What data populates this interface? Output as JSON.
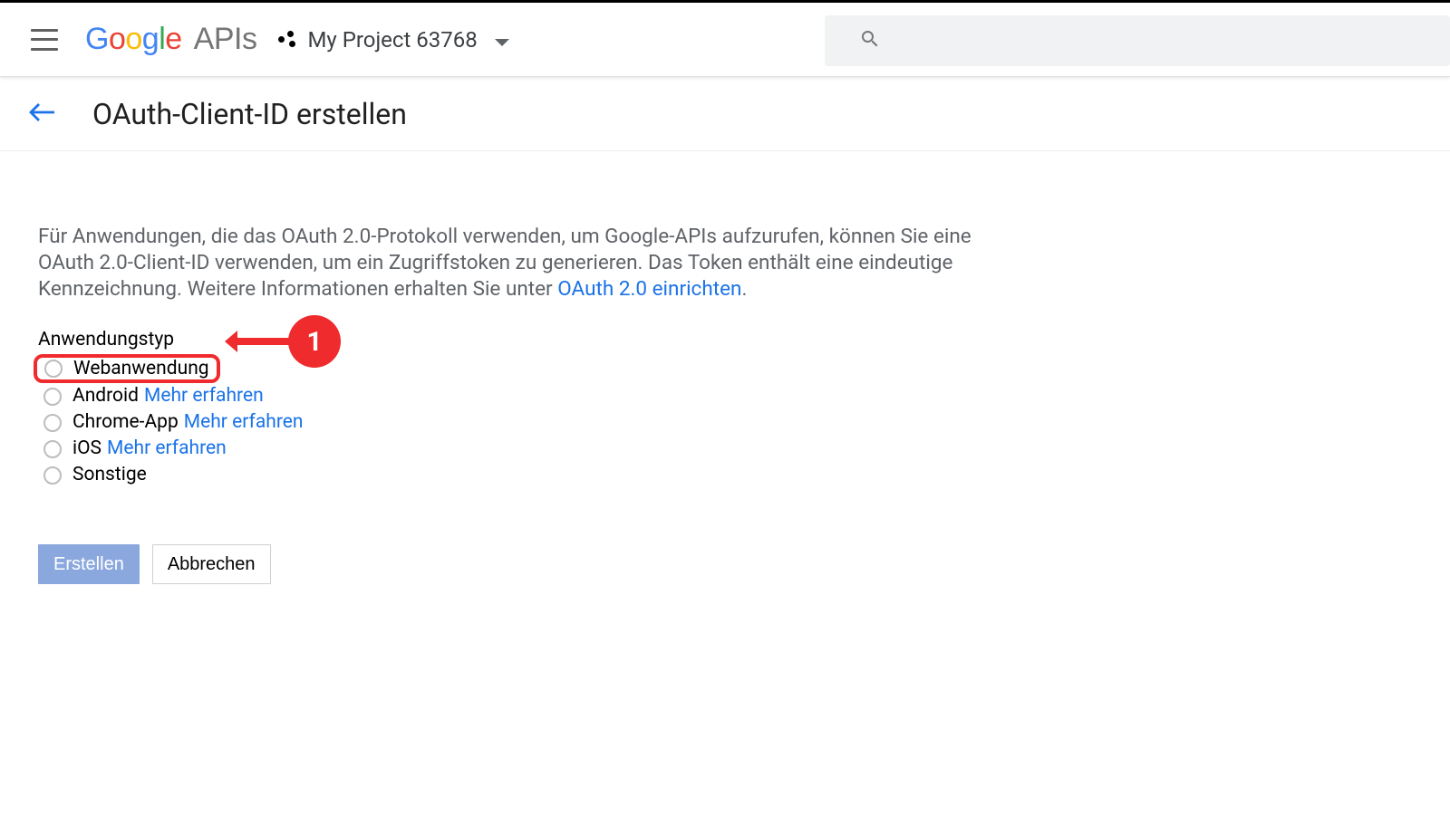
{
  "header": {
    "project_name": "My Project 63768"
  },
  "page": {
    "title": "OAuth-Client-ID erstellen"
  },
  "intro": {
    "text_1": "Für Anwendungen, die das OAuth 2.0-Protokoll verwenden, um Google-APIs aufzurufen, können Sie eine OAuth 2.0-Client-ID verwenden, um ein Zugriffstoken zu generieren. Das Token enthält eine eindeutige Kennzeichnung. Weitere Informationen erhalten Sie unter ",
    "link": "OAuth 2.0 einrichten",
    "dot": "."
  },
  "form": {
    "section_label": "Anwendungstyp",
    "options": {
      "opt0": {
        "label": "Webanwendung"
      },
      "opt1": {
        "label": "Android",
        "link": "Mehr erfahren"
      },
      "opt2": {
        "label": "Chrome-App",
        "link": "Mehr erfahren"
      },
      "opt3": {
        "label": "iOS",
        "link": "Mehr erfahren"
      },
      "opt4": {
        "label": "Sonstige"
      }
    }
  },
  "buttons": {
    "create": "Erstellen",
    "cancel": "Abbrechen"
  },
  "annotation": {
    "badge": "1"
  }
}
